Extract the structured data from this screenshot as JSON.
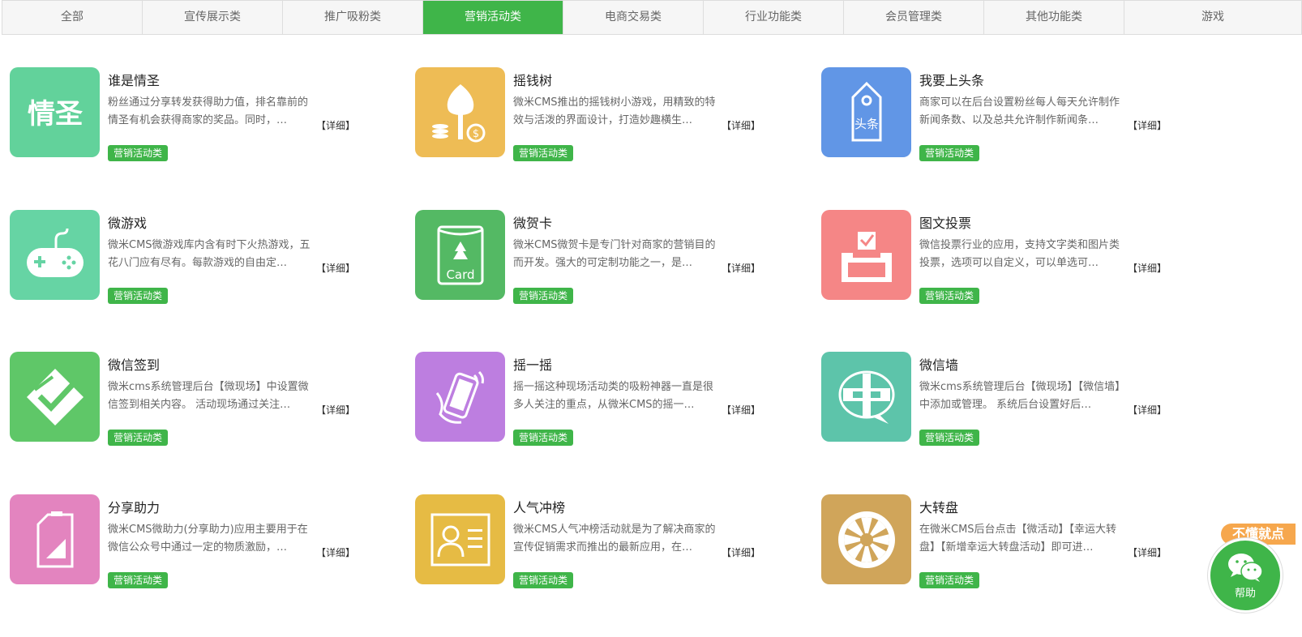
{
  "tabs": [
    {
      "label": "全部",
      "active": false
    },
    {
      "label": "宣传展示类",
      "active": false
    },
    {
      "label": "推广吸粉类",
      "active": false
    },
    {
      "label": "营销活动类",
      "active": true
    },
    {
      "label": "电商交易类",
      "active": false
    },
    {
      "label": "行业功能类",
      "active": false
    },
    {
      "label": "会员管理类",
      "active": false
    },
    {
      "label": "其他功能类",
      "active": false
    },
    {
      "label": "游戏",
      "active": false
    }
  ],
  "more_label": "【详细】",
  "tag_label": "营销活动类",
  "cards": [
    {
      "title": "谁是情圣",
      "desc": "粉丝通过分享转发获得助力值，排名靠前的情圣有机会获得商家的奖品。同时，…",
      "color": "#62d29b",
      "icon": "qingsheng-text-icon",
      "icon_text": "情圣"
    },
    {
      "title": "摇钱树",
      "desc": "微米CMS推出的摇钱树小游戏，用精致的特效与活泼的界面设计，打造妙趣横生…",
      "color": "#eebc55",
      "icon": "money-tree-icon",
      "icon_text": ""
    },
    {
      "title": "我要上头条",
      "desc": "商家可以在后台设置粉丝每人每天允许制作新闻条数、以及总共允许制作新闻条…",
      "color": "#6196e6",
      "icon": "headline-tag-icon",
      "icon_text": "头条"
    },
    {
      "title": "微游戏",
      "desc": "微米CMS微游戏库内含有时下火热游戏，五花八门应有尽有。每款游戏的自由定…",
      "color": "#66d4a4",
      "icon": "gamepad-icon",
      "icon_text": ""
    },
    {
      "title": "微贺卡",
      "desc": "微米CMS微贺卡是专门针对商家的营销目的而开发。强大的可定制功能之一，是…",
      "color": "#54b964",
      "icon": "greeting-card-icon",
      "icon_text": "Card"
    },
    {
      "title": "图文投票",
      "desc": "微信投票行业的应用，支持文字类和图片类投票，选项可以自定义，可以单选可…",
      "color": "#f58686",
      "icon": "ballot-box-icon",
      "icon_text": ""
    },
    {
      "title": "微信签到",
      "desc": "微米cms系统管理后台【微现场】中设置微信签到相关内容。 活动现场通过关注…",
      "color": "#5fc768",
      "icon": "check-in-icon",
      "icon_text": ""
    },
    {
      "title": "摇一摇",
      "desc": "摇一摇这种现场活动类的吸粉神器一直是很多人关注的重点，从微米CMS的摇一…",
      "color": "#bd7ee0",
      "icon": "shake-phone-icon",
      "icon_text": ""
    },
    {
      "title": "微信墙",
      "desc": "微米cms系统管理后台【微现场】【微信墙】中添加或管理。 系统后台设置好后…",
      "color": "#5dc4aa",
      "icon": "wechat-wall-icon",
      "icon_text": ""
    },
    {
      "title": "分享助力",
      "desc": "微米CMS微助力(分享助力)应用主要用于在微信公众号中通过一定的物质激励，…",
      "color": "#e384bf",
      "icon": "share-boost-icon",
      "icon_text": ""
    },
    {
      "title": "人气冲榜",
      "desc": "微米CMS人气冲榜活动就是为了解决商家的宣传促销需求而推出的最新应用，在…",
      "color": "#e6bb44",
      "icon": "popularity-card-icon",
      "icon_text": ""
    },
    {
      "title": "大转盘",
      "desc": "在微米CMS后台点击【微活动】【幸运大转盘】【新增幸运大转盘活动】即可进…",
      "color": "#d0a55a",
      "icon": "lucky-wheel-icon",
      "icon_text": ""
    }
  ],
  "help": {
    "badge": "不懂就点",
    "label": "帮助",
    "icon": "wechat-bubbles-icon"
  }
}
